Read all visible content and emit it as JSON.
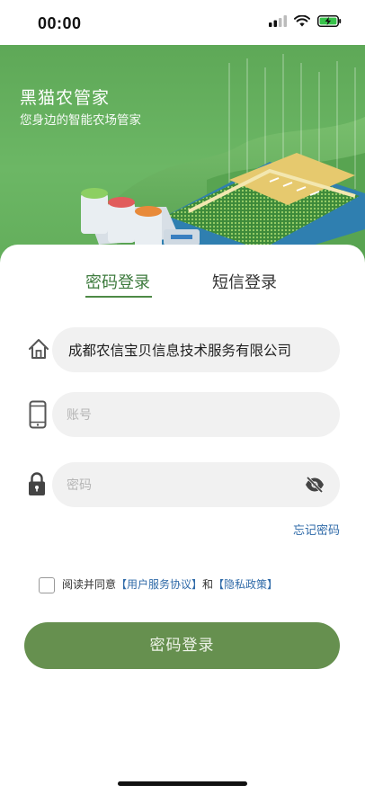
{
  "status_bar": {
    "time": "00:00"
  },
  "hero": {
    "title": "黑猫农管家",
    "subtitle": "您身边的智能农场管家"
  },
  "tabs": [
    {
      "label": "密码登录",
      "active": true
    },
    {
      "label": "短信登录",
      "active": false
    }
  ],
  "form": {
    "company_value": "成都农信宝贝信息技术服务有限公司",
    "account_placeholder": "账号",
    "password_placeholder": "密码",
    "forgot_password": "忘记密码"
  },
  "agreement": {
    "prefix": "阅读并同意",
    "user_agreement": "【用户服务协议】",
    "and": "和",
    "privacy_policy": "【隐私政策】",
    "checked": false
  },
  "login_button": "密码登录",
  "colors": {
    "brand_green": "#66904f",
    "hero_green": "#62ad5a",
    "link_blue": "#2f6aa8",
    "tab_active": "#3c7a3c"
  }
}
